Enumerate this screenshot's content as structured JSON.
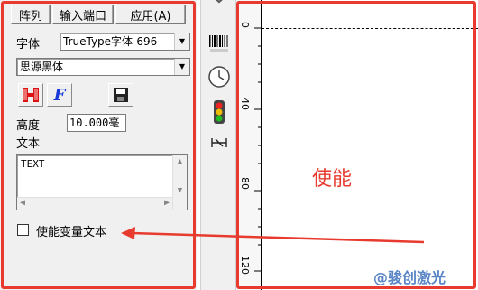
{
  "panel": {
    "buttons": {
      "array": "阵列",
      "input_port": "输入端口",
      "apply": "应用(A)"
    },
    "font_label": "字体",
    "font_type_value": "TrueType字体-696",
    "font_name_value": "思源黑体",
    "height_label": "高度",
    "height_value": "10.000毫",
    "text_label": "文本",
    "text_value": "TEXT",
    "variable_text_label": "使能变量文本"
  },
  "annotation": {
    "callout": "使能"
  },
  "ruler": {
    "ticks": [
      "0",
      "40",
      "80",
      "120"
    ]
  },
  "watermark": "@骏创激光",
  "colors": {
    "annotation_red": "#e83a2e",
    "watermark_blue": "#5a86c6"
  }
}
